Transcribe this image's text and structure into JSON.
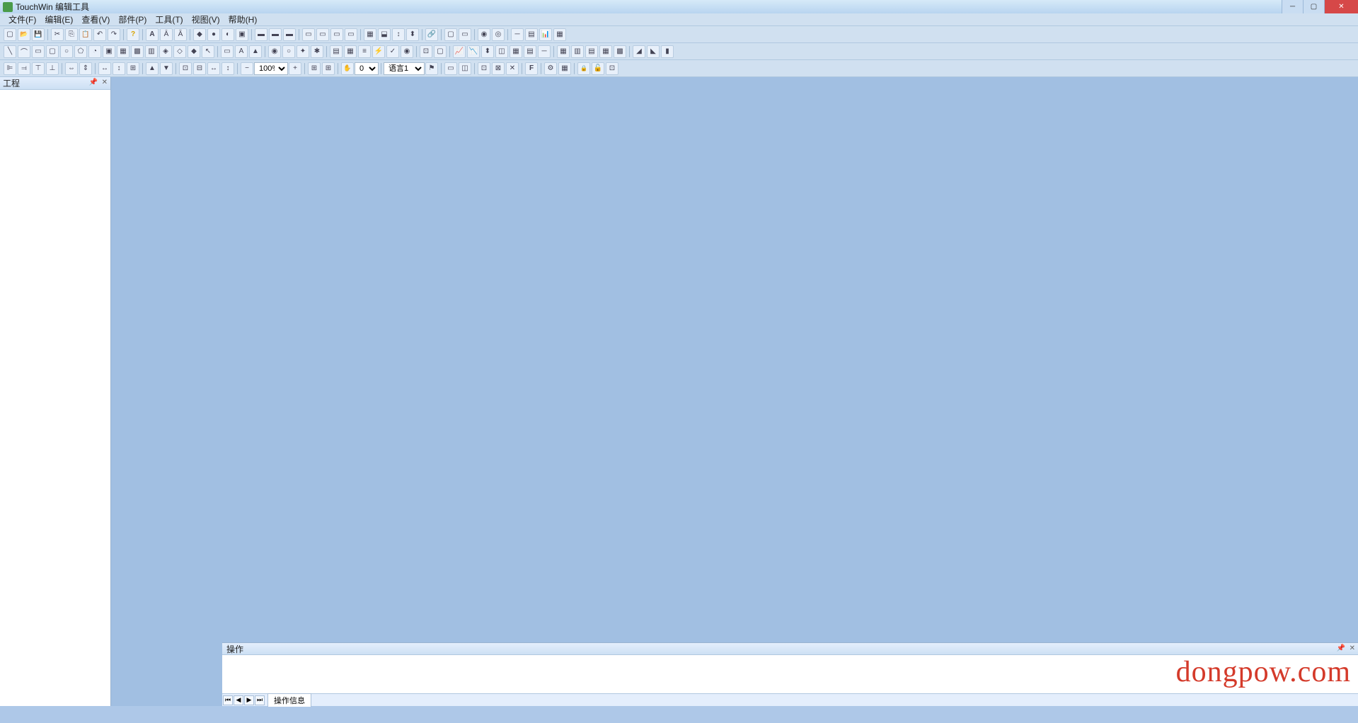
{
  "window": {
    "title": "TouchWin 编辑工具"
  },
  "menu": {
    "file": "文件(F)",
    "edit": "编辑(E)",
    "view": "查看(V)",
    "parts": "部件(P)",
    "tools": "工具(T)",
    "display": "视图(V)",
    "help": "帮助(H)"
  },
  "toolbar4": {
    "zoom": "100%",
    "state": "0",
    "language": "语言1"
  },
  "sidebar": {
    "title": "工程"
  },
  "bottom": {
    "title": "操作",
    "tab": "操作信息"
  },
  "watermark": "dongpow.com"
}
